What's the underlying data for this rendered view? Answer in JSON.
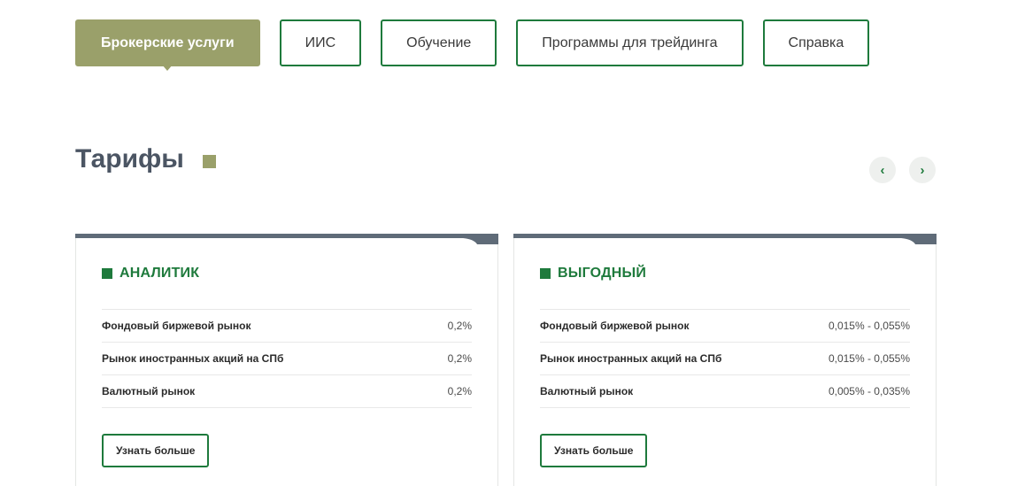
{
  "tabs": [
    {
      "label": "Брокерские услуги",
      "active": true
    },
    {
      "label": "ИИС",
      "active": false
    },
    {
      "label": "Обучение",
      "active": false
    },
    {
      "label": "Программы для трейдинга",
      "active": false
    },
    {
      "label": "Справка",
      "active": false
    }
  ],
  "section": {
    "title": "Тарифы"
  },
  "carousel": {
    "prev_icon": "chevron-left-icon",
    "next_icon": "chevron-right-icon"
  },
  "colors": {
    "accent": "#1e7a3c",
    "olive": "#9aa06a",
    "bar": "#5f6b78",
    "title": "#4b5563"
  },
  "cards": [
    {
      "title": "АНАЛИТИК",
      "rows": [
        {
          "label": "Фондовый биржевой рынок",
          "value": "0,2%"
        },
        {
          "label": "Рынок иностранных акций на СПб",
          "value": "0,2%"
        },
        {
          "label": "Валютный рынок",
          "value": "0,2%"
        }
      ],
      "button": "Узнать больше"
    },
    {
      "title": "ВЫГОДНЫЙ",
      "rows": [
        {
          "label": "Фондовый биржевой рынок",
          "value": "0,015% - 0,055%"
        },
        {
          "label": "Рынок иностранных акций на СПб",
          "value": "0,015% - 0,055%"
        },
        {
          "label": "Валютный рынок",
          "value": "0,005% - 0,035%"
        }
      ],
      "button": "Узнать больше"
    }
  ]
}
